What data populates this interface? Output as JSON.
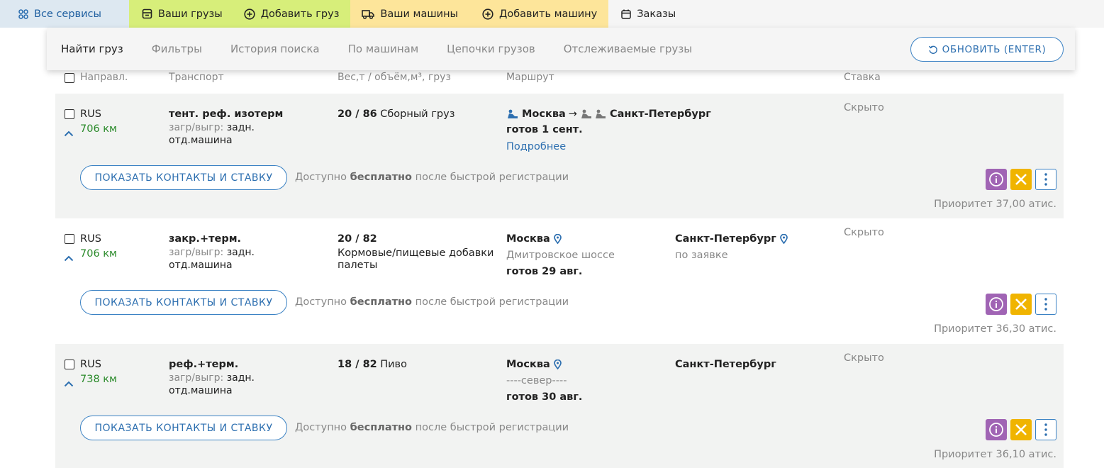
{
  "topnav": {
    "all_services": "Все сервисы",
    "your_cargo": "Ваши грузы",
    "add_cargo": "Добавить груз",
    "your_trucks": "Ваши машины",
    "add_truck": "Добавить машину",
    "orders": "Заказы"
  },
  "tabs": {
    "find_cargo": "Найти груз",
    "filters": "Фильтры",
    "search_history": "История поиска",
    "by_trucks": "По машинам",
    "cargo_chains": "Цепочки грузов",
    "tracked_cargo": "Отслеживаемые грузы",
    "refresh": "ОБНОВИТЬ (ENTER)"
  },
  "columns": {
    "direction": "Направл.",
    "transport": "Транспорт",
    "weight": "Вес,т / объём,м³, груз",
    "route": "Маршрут",
    "rate": "Ставка"
  },
  "common": {
    "contacts_button": "ПОКАЗАТЬ КОНТАКТЫ И СТАВКУ",
    "avail_prefix": "Доступно",
    "avail_free": "бесплатно",
    "avail_suffix": "после быстрой регистрации",
    "load_label": "загр/выгр:",
    "load_value": "задн.",
    "separate_truck": "отд.машина",
    "hidden": "Скрыто"
  },
  "rows": [
    {
      "country": "RUS",
      "km": "706 км",
      "transport": "тент. реф. изотерм",
      "weight": "20 / 86",
      "cargo": "Сборный груз",
      "from": "Москва",
      "arrow": "→",
      "to": "Санкт-Петербург",
      "ready": "готов 1 сент.",
      "details": "Подробнее",
      "priority": "Приоритет 37,00 атис."
    },
    {
      "country": "RUS",
      "km": "706 км",
      "transport": "закр.+терм.",
      "weight": "20 / 82",
      "cargo_line1": "Кормовые/пищевые добавки",
      "cargo_line2": "палеты",
      "from": "Москва",
      "from_sub": "Дмитровское шоссе",
      "ready": "готов 29 авг.",
      "to": "Санкт-Петербург",
      "to_sub": "по заявке",
      "priority": "Приоритет 36,30 атис."
    },
    {
      "country": "RUS",
      "km": "738 км",
      "transport": "реф.+терм.",
      "weight": "18 / 82",
      "cargo": "Пиво",
      "from": "Москва",
      "from_sub": "----север----",
      "ready": "готов 30 авг.",
      "to": "Санкт-Петербург",
      "priority": "Приоритет 36,10 атис."
    }
  ],
  "colors": {
    "accent": "#2d6fb0",
    "green_nav": "#d7ee7a",
    "yellow_nav": "#fde59a",
    "km_green": "#2a8a2a",
    "info_purple": "#a064b4",
    "close_yellow": "#f0b400"
  }
}
